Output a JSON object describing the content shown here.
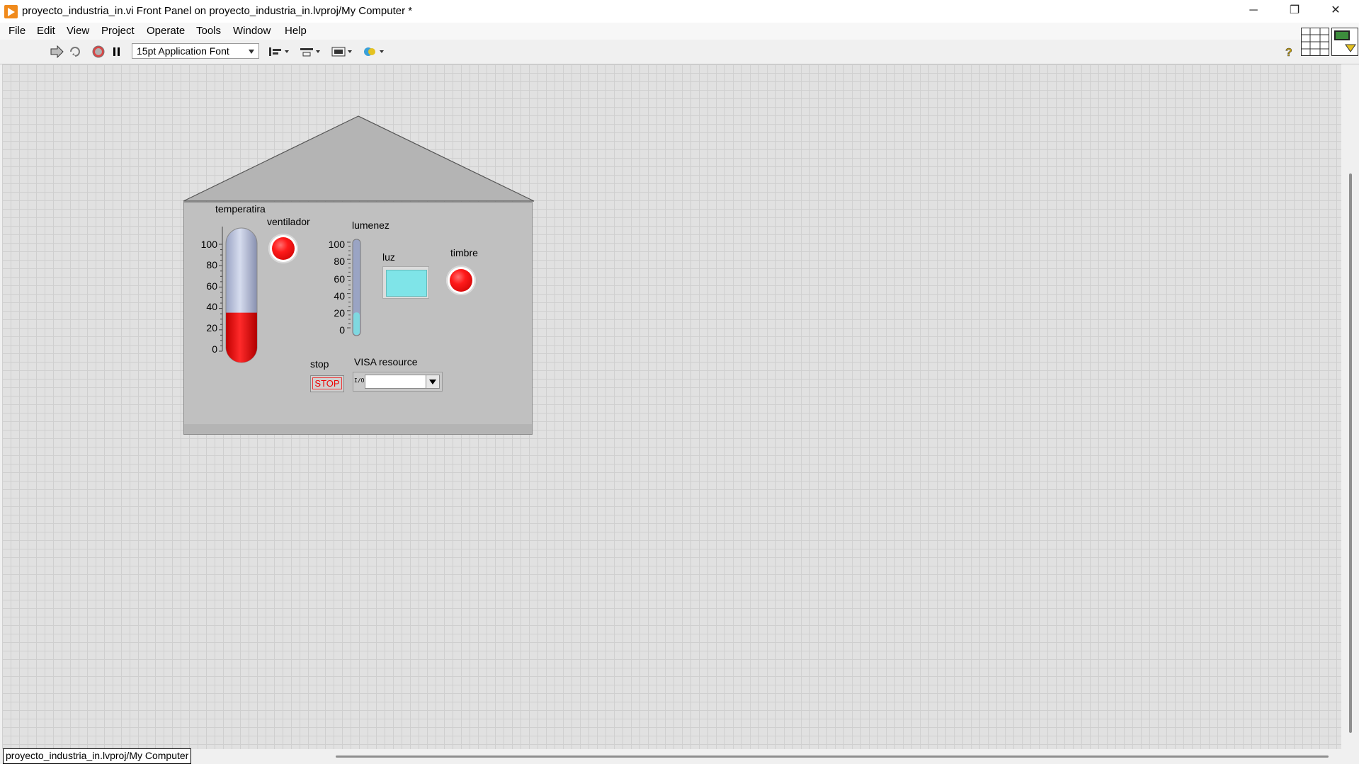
{
  "window": {
    "title": "proyecto_industria_in.vi Front Panel on proyecto_industria_in.lvproj/My Computer *",
    "minimize": "─",
    "restore": "❐",
    "close": "✕"
  },
  "menu": [
    "File",
    "Edit",
    "View",
    "Project",
    "Operate",
    "Tools",
    "Window",
    "Help"
  ],
  "toolbar": {
    "font": "15pt Application Font",
    "help": "?"
  },
  "panel": {
    "thermometer": {
      "label": "temperatira",
      "value": 36,
      "ticks": [
        "100",
        "80",
        "60",
        "40",
        "20",
        "0"
      ],
      "fill_color": "#e00000"
    },
    "fan_led": {
      "label": "ventilador",
      "on": true,
      "color": "#ff0000"
    },
    "lumen_slider": {
      "label": "lumenez",
      "value": 18,
      "ticks": [
        "100",
        "80",
        "60",
        "40",
        "20",
        "0"
      ],
      "fill_color": "#7fd8e0"
    },
    "light_indicator": {
      "label": "luz",
      "color": "#7fe4e8"
    },
    "bell_led": {
      "label": "timbre",
      "on": true,
      "color": "#ff0000"
    },
    "stop": {
      "label": "stop",
      "button_text": "STOP"
    },
    "visa": {
      "label": "VISA resource",
      "value": "",
      "icon": "I/O"
    }
  },
  "status": {
    "context": "proyecto_industria_in.lvproj/My Computer"
  }
}
